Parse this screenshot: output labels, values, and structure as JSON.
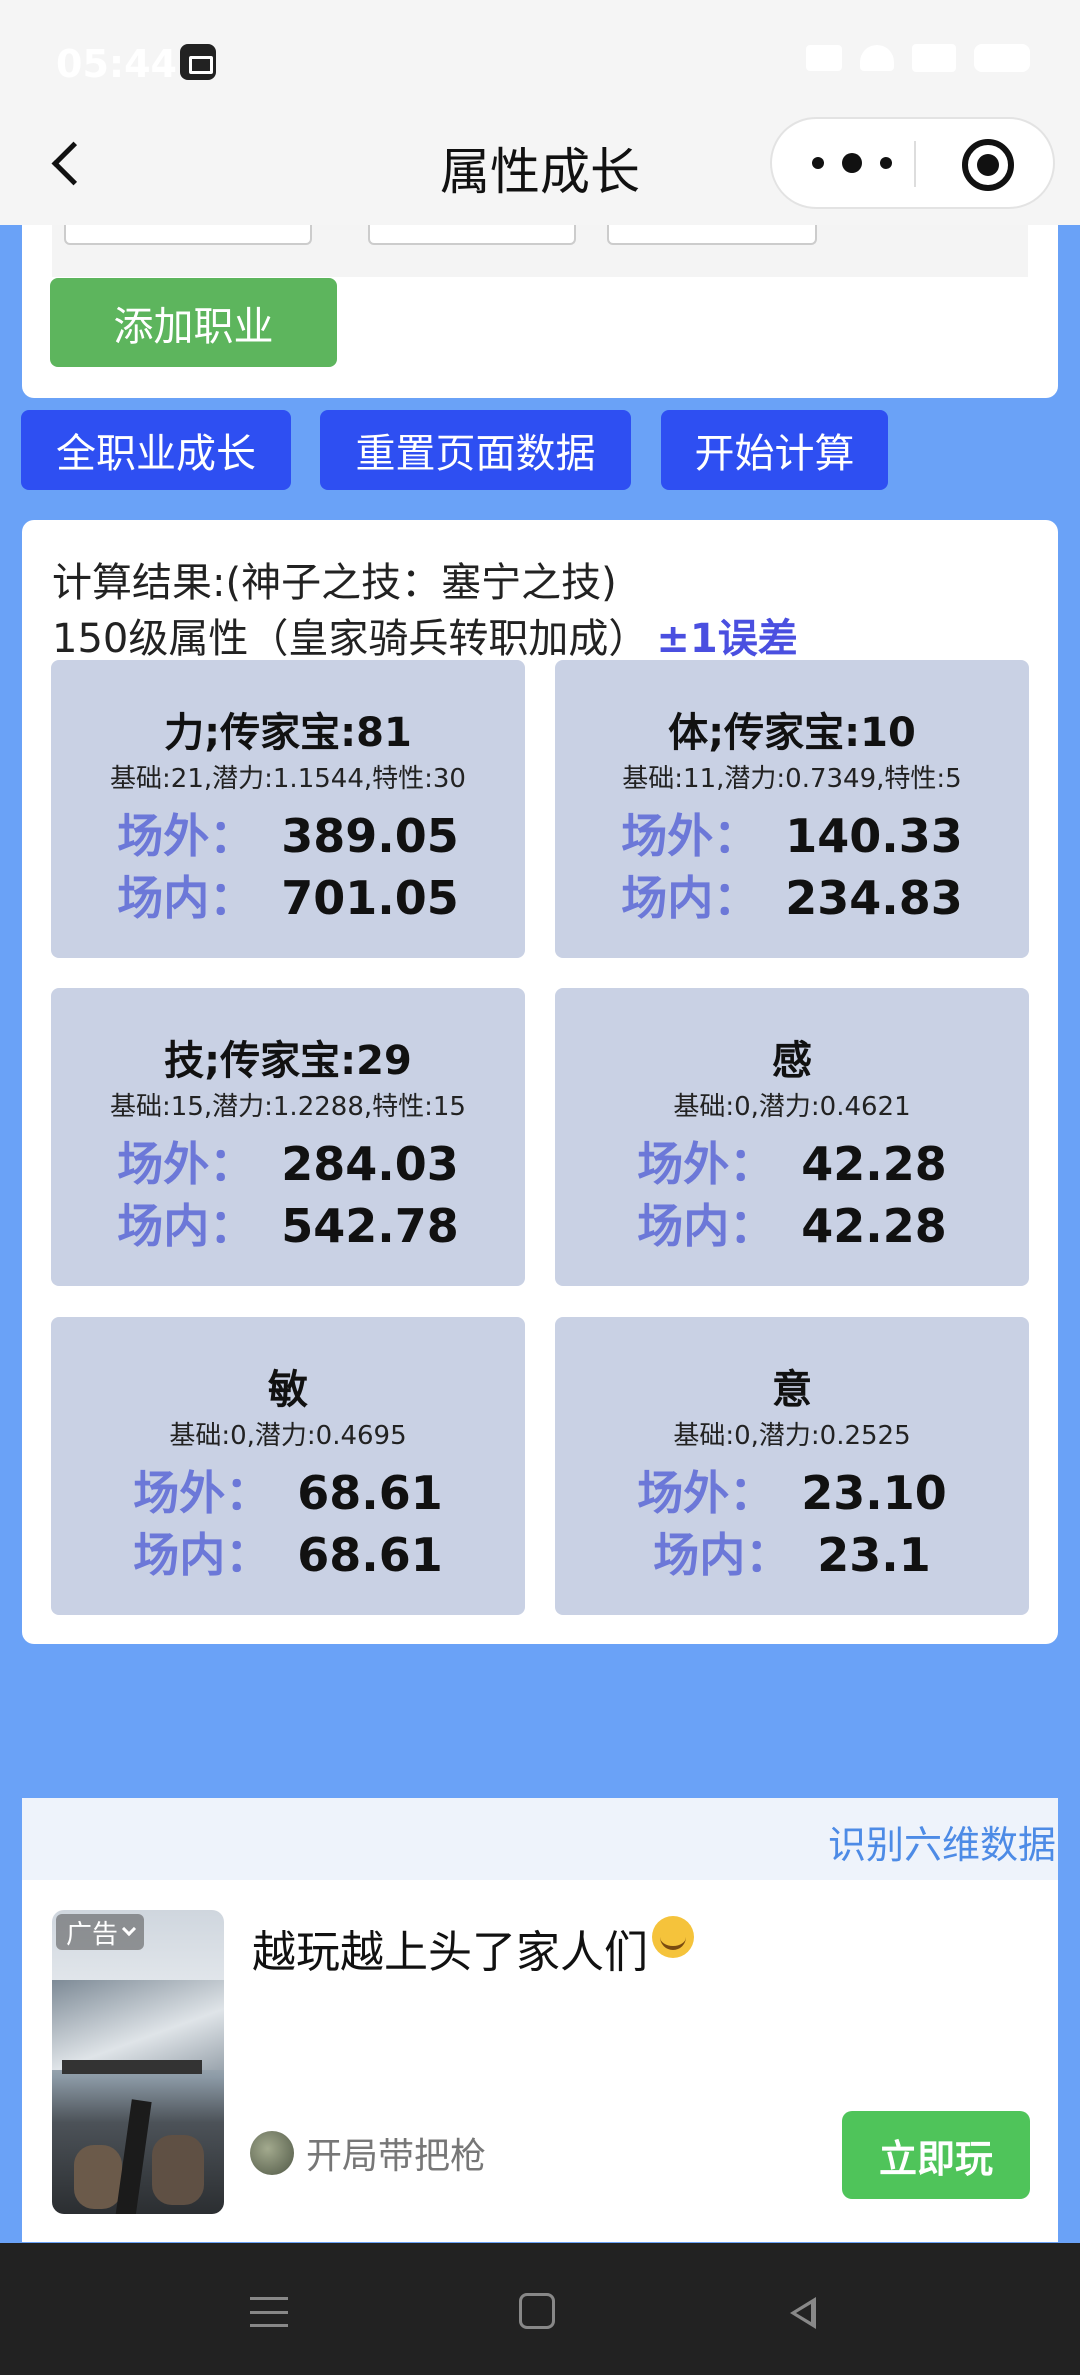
{
  "status_bar": {
    "time": "05:44"
  },
  "header": {
    "title": "属性成长"
  },
  "top_section": {
    "add_job_label": "添加职业"
  },
  "actions": [
    {
      "label": "全职业成长"
    },
    {
      "label": "重置页面数据"
    },
    {
      "label": "开始计算"
    }
  ],
  "results": {
    "heading": "计算结果:(神子之技：塞宁之技)",
    "subheading": "150级属性（皇家骑兵转职加成）",
    "error_note": "±1误差",
    "outside_label": "场外：",
    "inside_label": "场内：",
    "stats": [
      {
        "name": "力;传家宝:81",
        "detail": "基础:21,潜力:1.1544,特性:30",
        "outside": "389.05",
        "inside": "701.05"
      },
      {
        "name": "体;传家宝:10",
        "detail": "基础:11,潜力:0.7349,特性:5",
        "outside": "140.33",
        "inside": "234.83"
      },
      {
        "name": "技;传家宝:29",
        "detail": "基础:15,潜力:1.2288,特性:15",
        "outside": "284.03",
        "inside": "542.78"
      },
      {
        "name": "感",
        "detail": "基础:0,潜力:0.4621",
        "outside": "42.28",
        "inside": "42.28"
      },
      {
        "name": "敏",
        "detail": "基础:0,潜力:0.4695",
        "outside": "68.61",
        "inside": "68.61"
      },
      {
        "name": "意",
        "detail": "基础:0,潜力:0.2525",
        "outside": "23.10",
        "inside": "23.1"
      }
    ]
  },
  "ad": {
    "header_link": "识别六维数据",
    "tag": "广告",
    "title": "越玩越上头了家人们",
    "author": "开局带把枪",
    "cta": "立即玩"
  },
  "colors": {
    "page_bg": "#6aa2f7",
    "primary_button": "#2e4ff2",
    "add_button": "#5db55d",
    "stat_card": "#c9d1e4",
    "stat_label": "#6c78d8",
    "cta_green": "#4fc45a"
  },
  "icons": [
    "back-arrow-icon",
    "more-dots-icon",
    "target-circle-icon",
    "chevron-down-icon",
    "menu-icon",
    "home-icon",
    "back-triangle-icon"
  ]
}
